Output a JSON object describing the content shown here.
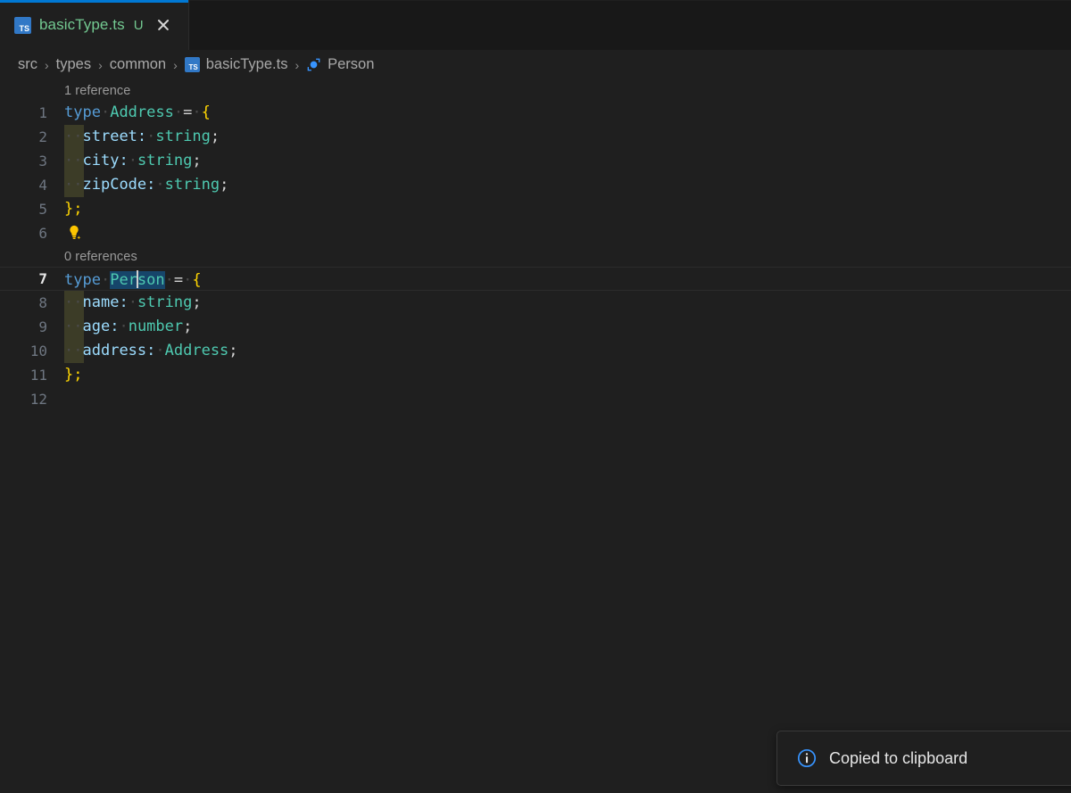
{
  "tab": {
    "file_icon": "typescript-file-icon",
    "file_icon_label": "TS",
    "label": "basicType.ts",
    "git_badge": "U",
    "close_icon": "close-icon"
  },
  "breadcrumb": {
    "separator": "›",
    "items": [
      {
        "label": "src",
        "icon": null
      },
      {
        "label": "types",
        "icon": null
      },
      {
        "label": "common",
        "icon": null
      },
      {
        "label": "basicType.ts",
        "icon": "typescript-file-icon",
        "icon_label": "TS"
      },
      {
        "label": "Person",
        "icon": "symbol-interface-icon"
      }
    ]
  },
  "editor": {
    "codelens": {
      "address_references": "1 reference",
      "person_references": "0 references"
    },
    "line_numbers": [
      "1",
      "2",
      "3",
      "4",
      "5",
      "6",
      "7",
      "8",
      "9",
      "10",
      "11",
      "12"
    ],
    "active_line": 7,
    "cursor": {
      "line": 7,
      "column": 9
    },
    "selection": {
      "line": 7,
      "text": "Person"
    },
    "lightbulb_line": 6,
    "lightbulb_icon": "lightbulb-sparkle-icon",
    "lines": {
      "l1_kw": "type",
      "l1_name": "Address",
      "l1_eq": "=",
      "l1_brace": "{",
      "l2_prop": "street:",
      "l2_type": "string",
      "l3_prop": "city:",
      "l3_type": "string",
      "l4_prop": "zipCode:",
      "l4_type": "string",
      "l5_close": "};",
      "l7_kw": "type",
      "l7_name_a": "Per",
      "l7_name_b": "son",
      "l7_eq": "=",
      "l7_brace": "{",
      "l8_prop": "name:",
      "l8_type": "string",
      "l9_prop": "age:",
      "l9_type": "number",
      "l10_prop": "address:",
      "l10_type": "Address",
      "l11_close": "};",
      "semi": ";",
      "ws_dot": "·"
    }
  },
  "notification": {
    "icon": "info-circle-icon",
    "message": "Copied to clipboard"
  },
  "colors": {
    "accent": "#0078d4",
    "tab_modified": "#73c991",
    "keyword": "#569cd6",
    "type": "#4ec9b0",
    "property": "#9cdcfe",
    "brace": "#ffd602",
    "selection": "#16456a",
    "info": "#3794ff",
    "editor_bg": "#1f1f1f"
  }
}
